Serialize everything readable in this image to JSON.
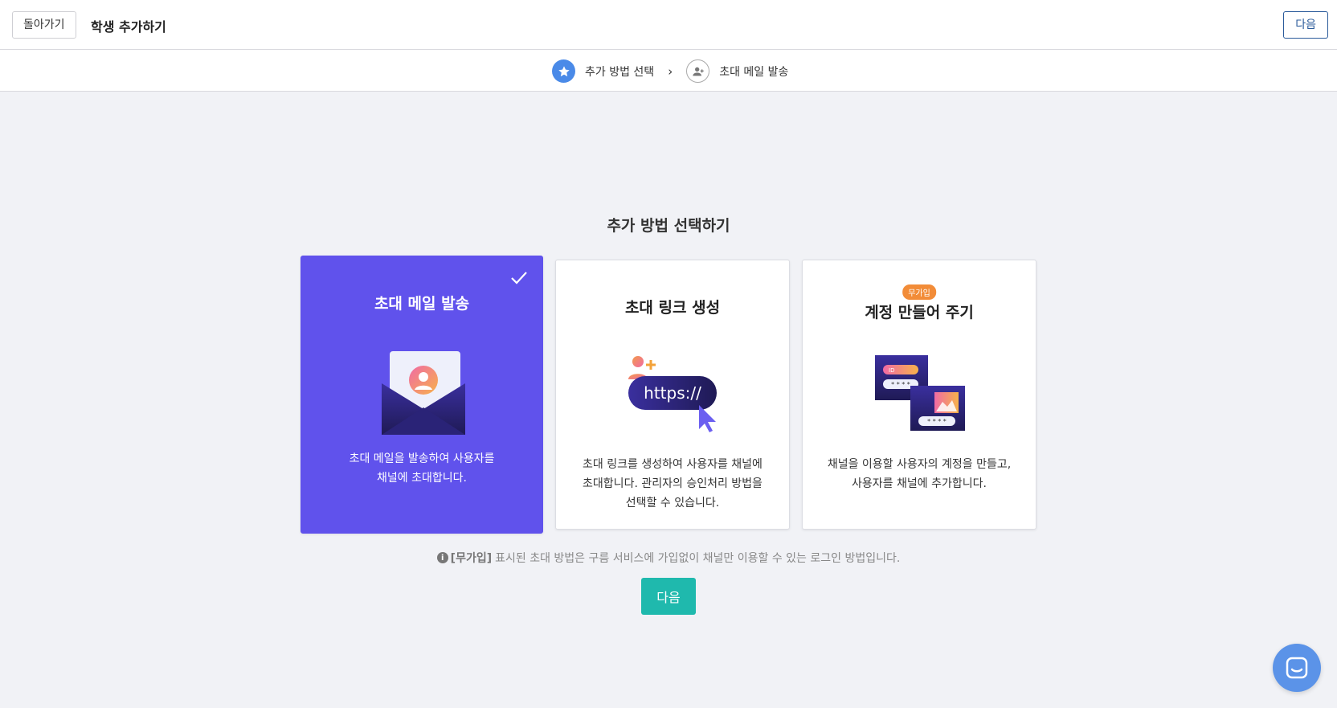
{
  "header": {
    "back_label": "돌아가기",
    "title": "학생 추가하기",
    "next_label": "다음"
  },
  "steps": [
    {
      "label": "추가 방법 선택",
      "icon": "star-icon",
      "active": true
    },
    {
      "label": "초대 메일 발송",
      "icon": "user-add-icon",
      "active": false
    }
  ],
  "step_separator": "›",
  "main": {
    "title": "추가 방법 선택하기",
    "cards": [
      {
        "title": "초대 메일 발송",
        "desc_line1": "초대 메일을 발송하여 사용자를",
        "desc_line2": "채널에 초대합니다.",
        "selected": true,
        "icon": "mail-invite-icon"
      },
      {
        "title": "초대 링크 생성",
        "desc_line1": "초대 링크를 생성하여 사용자를 채널에",
        "desc_line2": "초대합니다. 관리자의 승인처리 방법을",
        "desc_line3": "선택할 수 있습니다.",
        "selected": false,
        "icon": "link-https-icon",
        "link_text": "https://"
      },
      {
        "title": "계정 만들어 주기",
        "badge": "무가입",
        "desc_line1": "채널을 이용할 사용자의 계정을 만들고,",
        "desc_line2": "사용자를 채널에 추가합니다.",
        "selected": false,
        "icon": "account-create-icon",
        "id_text": "ID",
        "password_mask": "* * * *"
      }
    ],
    "note_strong": "[무가입]",
    "note_text": "표시된 초대 방법은 구름 서비스에 가입없이 채널만 이용할 수 있는 로그인 방법입니다.",
    "info_glyph": "i",
    "next_label": "다음"
  },
  "colors": {
    "selected_card": "#6052ec",
    "next_button": "#1fb9ad",
    "step_active": "#4a8ae8",
    "chat_button": "#5b93e8",
    "badge": "#f28c38"
  }
}
